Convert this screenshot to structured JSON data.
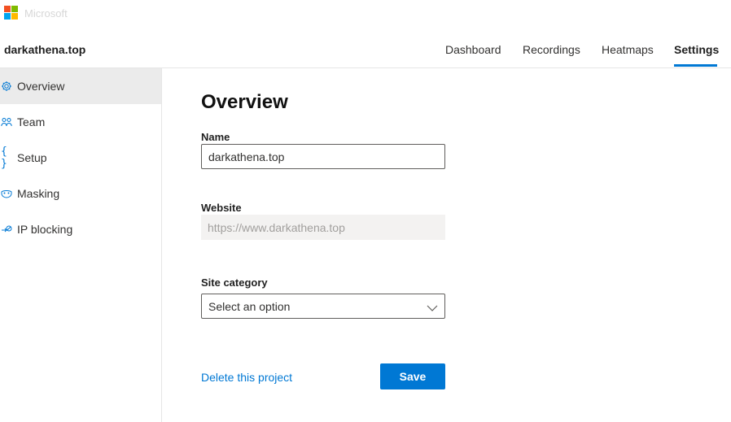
{
  "brand": {
    "text": "Microsoft",
    "logo_colors": [
      "#f25022",
      "#7fba00",
      "#00a4ef",
      "#ffb900"
    ]
  },
  "header": {
    "project_name": "darkathena.top",
    "nav": [
      {
        "label": "Dashboard",
        "active": false
      },
      {
        "label": "Recordings",
        "active": false
      },
      {
        "label": "Heatmaps",
        "active": false
      },
      {
        "label": "Settings",
        "active": true
      }
    ]
  },
  "sidebar": {
    "items": [
      {
        "label": "Overview",
        "icon": "gear-icon",
        "active": true
      },
      {
        "label": "Team",
        "icon": "team-icon",
        "active": false
      },
      {
        "label": "Setup",
        "icon": "braces-icon",
        "active": false
      },
      {
        "label": "Masking",
        "icon": "mask-icon",
        "active": false
      },
      {
        "label": "IP blocking",
        "icon": "ip-block-icon",
        "active": false
      }
    ]
  },
  "main": {
    "title": "Overview",
    "name_label": "Name",
    "name_value": "darkathena.top",
    "website_label": "Website",
    "website_value": "https://www.darkathena.top",
    "category_label": "Site category",
    "category_placeholder": "Select an option",
    "delete_link": "Delete this project",
    "save_button": "Save"
  },
  "colors": {
    "accent": "#0078d4",
    "sidebar_active_bg": "#ebebeb"
  }
}
